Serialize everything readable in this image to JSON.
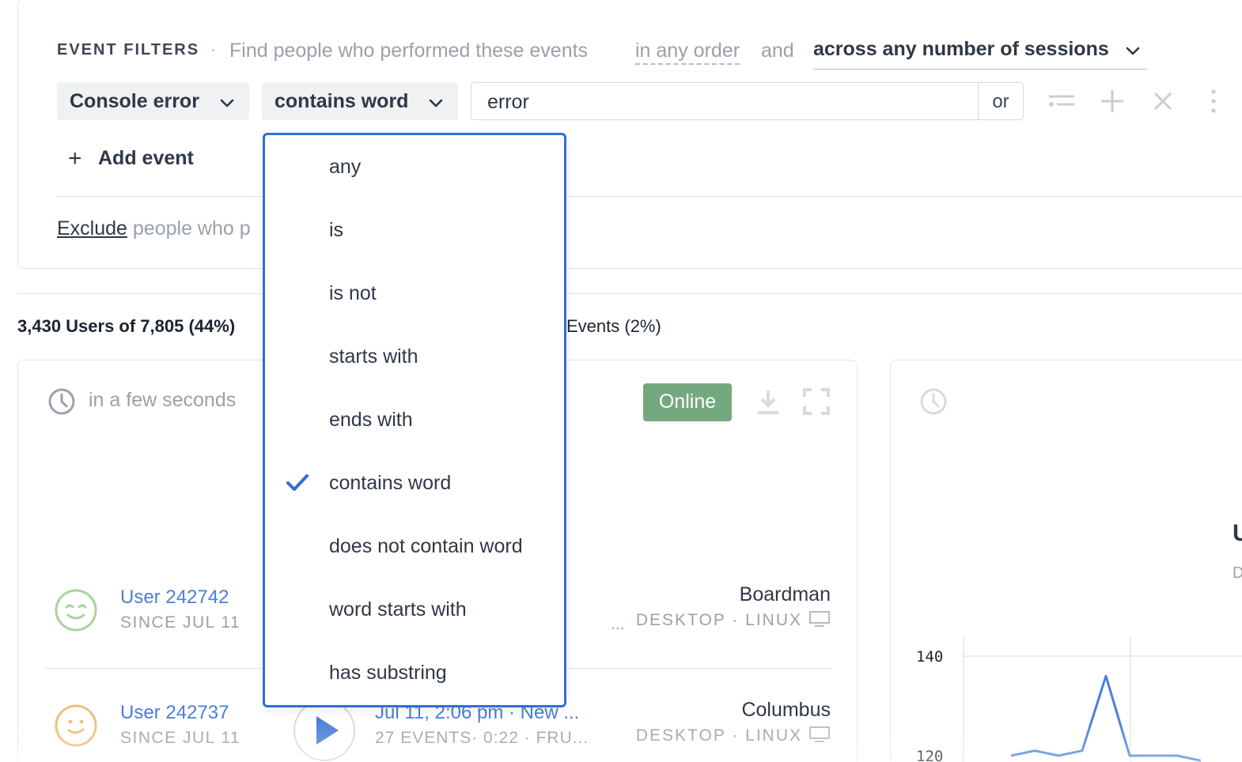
{
  "filters": {
    "section_label": "EVENT FILTERS",
    "separator": "·",
    "description": "Find people who performed these events",
    "order_option": "in any order",
    "and_text": "and",
    "sessions_option": "across any number of sessions",
    "event_type": "Console error",
    "operator": "contains word",
    "value": "error",
    "or_label": "or",
    "add_event_label": "Add event",
    "exclude_link": "Exclude",
    "exclude_rest": "people who p"
  },
  "stats": {
    "users_text": "3,430 Users of 7,805 (44%)",
    "events_text": "Events (2%)"
  },
  "sessions": {
    "recency": "in a few seconds",
    "online_label": "Online",
    "rows": [
      {
        "user": "User 242742",
        "since": "SINCE JUL 11",
        "meta_ellipsis": "...",
        "city": "Boardman",
        "device": "DESKTOP · LINUX"
      },
      {
        "user": "User 242737",
        "since": "SINCE JUL 11",
        "title": "Jul 11, 2:06 pm · New ...",
        "meta": "27 EVENTS· 0:22 · FRU...",
        "city": "Columbus",
        "device": "DESKTOP · LINUX"
      }
    ]
  },
  "chart_panel": {
    "cut_title": "U",
    "cut_subtitle": "D"
  },
  "chart_data": {
    "type": "line",
    "title": "",
    "xlabel": "",
    "ylabel": "",
    "y_ticks": [
      "140",
      "120"
    ],
    "ylim": [
      120,
      140
    ],
    "series": [
      {
        "values": [
          120,
          121,
          120,
          121,
          136,
          120,
          120,
          120,
          119
        ]
      }
    ],
    "grid": true,
    "color": "#4a7fd6"
  },
  "operator_menu": {
    "options": [
      {
        "label": "any",
        "selected": false
      },
      {
        "label": "is",
        "selected": false
      },
      {
        "label": "is not",
        "selected": false
      },
      {
        "label": "starts with",
        "selected": false
      },
      {
        "label": "ends with",
        "selected": false
      },
      {
        "label": "contains word",
        "selected": true
      },
      {
        "label": "does not contain word",
        "selected": false
      },
      {
        "label": "word starts with",
        "selected": false
      },
      {
        "label": "has substring",
        "selected": false
      }
    ]
  },
  "colors": {
    "accent": "#2f6fd9",
    "link": "#4a7fd6",
    "online": "#74a87f",
    "muted": "#9aa1ab"
  },
  "icons": [
    "chevron-down-icon",
    "filter-lines-icon",
    "plus-icon",
    "close-icon",
    "more-vertical-icon",
    "clock-icon",
    "download-icon",
    "expand-icon",
    "smiley-face-icon",
    "play-icon",
    "monitor-icon",
    "check-icon"
  ]
}
